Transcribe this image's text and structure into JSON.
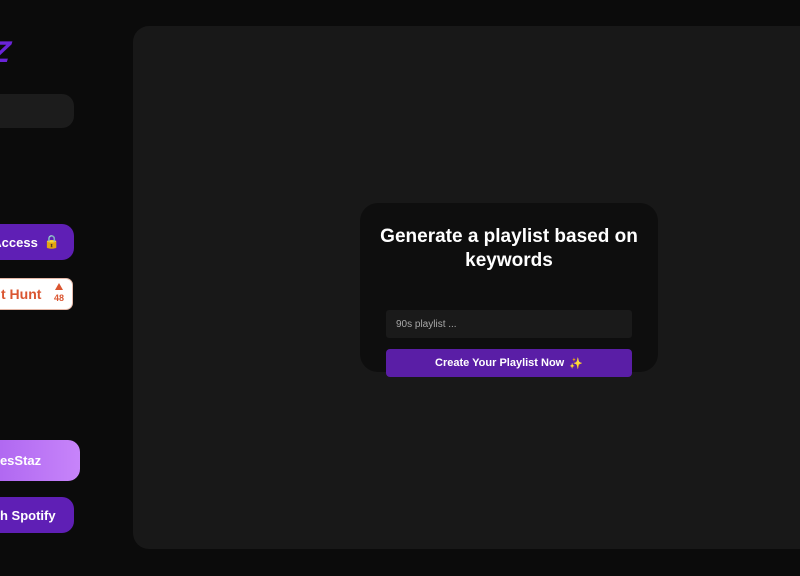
{
  "sidebar": {
    "logo_text": "DIZ",
    "early_access_label": "d Access",
    "early_access_icon": "lock-icon",
    "product_hunt": {
      "label": "t Hunt",
      "upvote_count": "48"
    },
    "blues_button_label": "uesStaz",
    "spotify_button_label": "h Spotify"
  },
  "main": {
    "card": {
      "title": "Generate a playlist based on keywords",
      "input_placeholder": "90s playlist ...",
      "create_button_label": "Create Your Playlist Now",
      "create_button_icon": "sparkle-icon"
    }
  },
  "colors": {
    "background": "#0b0b0b",
    "panel": "#181818",
    "card": "#0e0e0e",
    "accent_purple": "#5a1ea6",
    "logo_purple": "#6a24d8",
    "product_hunt_orange": "#da5530"
  }
}
